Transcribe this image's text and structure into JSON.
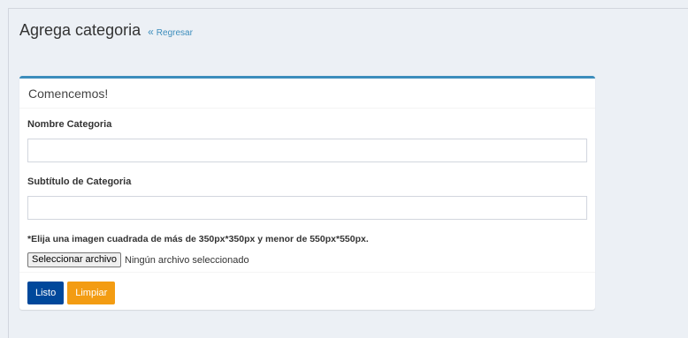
{
  "header": {
    "title": "Agrega categoria",
    "back_link": "Regresar",
    "back_icon": "«"
  },
  "form": {
    "box_title": "Comencemos!",
    "name_label": "Nombre Categoria",
    "name_value": "",
    "subtitle_label": "Subtítulo de Categoria",
    "subtitle_value": "",
    "image_help": "*Elija una imagen cuadrada de más de 350px*350px y menor de 550px*550px.",
    "file_button": "Seleccionar archivo",
    "file_status": "Ningún archivo seleccionado",
    "submit_label": "Listo",
    "clear_label": "Limpiar"
  },
  "colors": {
    "accent": "#3c8dbc",
    "primary_button": "#00489b",
    "warning_button": "#f39c12",
    "background": "#ecf0f5"
  }
}
